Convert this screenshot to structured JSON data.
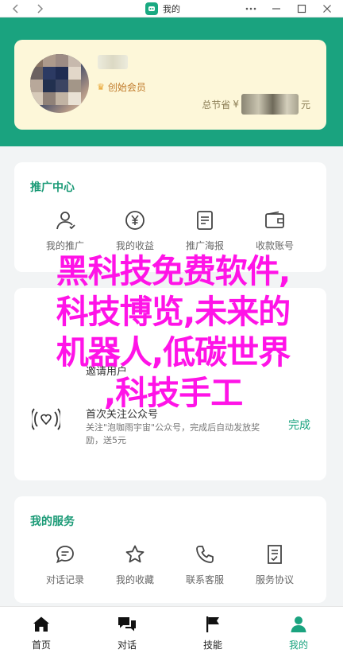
{
  "window": {
    "title": "我的",
    "back_icon": "chevron-left-icon",
    "forward_icon": "chevron-right-icon",
    "controls": [
      "more-icon",
      "minimize-icon",
      "maximize-icon",
      "close-icon"
    ]
  },
  "member": {
    "level_label": "创始会员",
    "saved_prefix": "总节省",
    "currency_symbol": "¥",
    "unit": "元"
  },
  "promo": {
    "title": "推广中心",
    "items": [
      {
        "label": "我的推广",
        "icon": "user-icon"
      },
      {
        "label": "我的收益",
        "icon": "yen-coin-icon"
      },
      {
        "label": "推广海报",
        "icon": "poster-icon"
      },
      {
        "label": "收款账号",
        "icon": "wallet-icon"
      }
    ]
  },
  "tasks": {
    "row1_title_suffix": "邀请用户",
    "row2_title_suffix": "首次关注公众号",
    "row2_desc": "关注\"泡咖雨宇宙\"公众号，完成后自动发放奖励，送5元",
    "row2_action": "完成"
  },
  "services": {
    "title": "我的服务",
    "items": [
      {
        "label": "对话记录",
        "icon": "chat-bubble-icon"
      },
      {
        "label": "我的收藏",
        "icon": "star-icon"
      },
      {
        "label": "联系客服",
        "icon": "phone-icon"
      },
      {
        "label": "服务协议",
        "icon": "document-icon"
      }
    ]
  },
  "nav": {
    "items": [
      {
        "label": "首页",
        "icon": "home-icon"
      },
      {
        "label": "对话",
        "icon": "chat-icon"
      },
      {
        "label": "技能",
        "icon": "flag-icon"
      },
      {
        "label": "我的",
        "icon": "person-icon"
      }
    ],
    "active_index": 3
  },
  "overlay": {
    "lines": [
      "黑科技免费软件,",
      "科技博览,未来的",
      "机器人,低碳世界",
      ",科技手工"
    ]
  },
  "colors": {
    "accent": "#1aa37f",
    "member_card": "#fdf7d9",
    "overlay_text": "#ff13e7"
  }
}
